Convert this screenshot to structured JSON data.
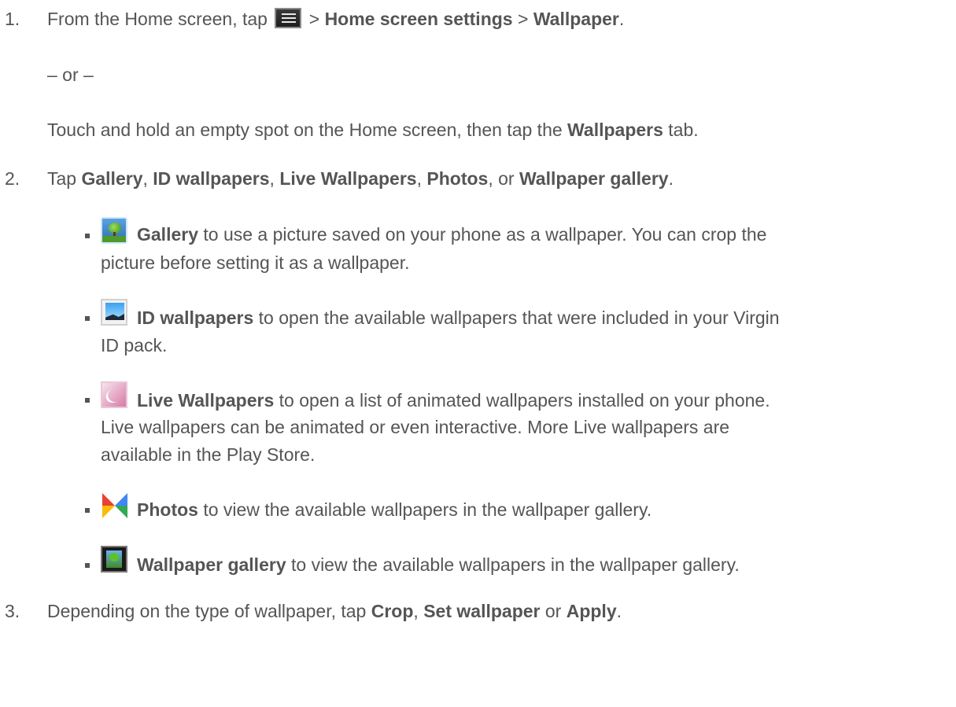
{
  "steps": {
    "step1": {
      "number": "1.",
      "pre_icon": "From the Home screen, tap",
      "icon": "menu-icon",
      "sep1": ">",
      "bold1": "Home screen settings",
      "sep2": ">",
      "bold2": "Wallpaper",
      "end": ".",
      "or": "– or –",
      "alt_pre": "Touch and hold an empty spot on the Home screen, then tap the",
      "alt_bold": "Wallpapers",
      "alt_post": "tab."
    },
    "step2": {
      "number": "2.",
      "pre": "Tap",
      "b1": "Gallery",
      "c1": ",",
      "b2": "ID wallpapers",
      "c2": ",",
      "b3": "Live Wallpapers",
      "c3": ",",
      "b4": "Photos",
      "c4": ", or",
      "b5": "Wallpaper gallery",
      "end": "."
    },
    "step3": {
      "number": "3.",
      "pre": "Depending on the type of wallpaper, tap",
      "b1": "Crop",
      "c1": ",",
      "b2": "Set wallpaper",
      "or": "or",
      "b3": "Apply",
      "end": "."
    }
  },
  "options": [
    {
      "icon": "gallery-icon",
      "title": "Gallery",
      "line1": "to use a picture saved on your phone as a wallpaper. You can crop the",
      "line2": "picture before setting it as a wallpaper."
    },
    {
      "icon": "id-wallpapers-icon",
      "title": "ID wallpapers",
      "line1": "to open the available wallpapers that were included in your Virgin",
      "line2": "ID pack."
    },
    {
      "icon": "live-wallpapers-icon",
      "title": "Live Wallpapers",
      "line1": "to open a list of animated wallpapers installed on your phone.",
      "line2": "Live wallpapers can be animated or even interactive. More Live wallpapers are",
      "line3": "available in the Play Store."
    },
    {
      "icon": "photos-icon",
      "title": "Photos",
      "line1": "to view the available wallpapers in the wallpaper gallery."
    },
    {
      "icon": "wallpaper-gallery-icon",
      "title": "Wallpaper gallery",
      "line1": "to view the available wallpapers in the wallpaper gallery."
    }
  ]
}
